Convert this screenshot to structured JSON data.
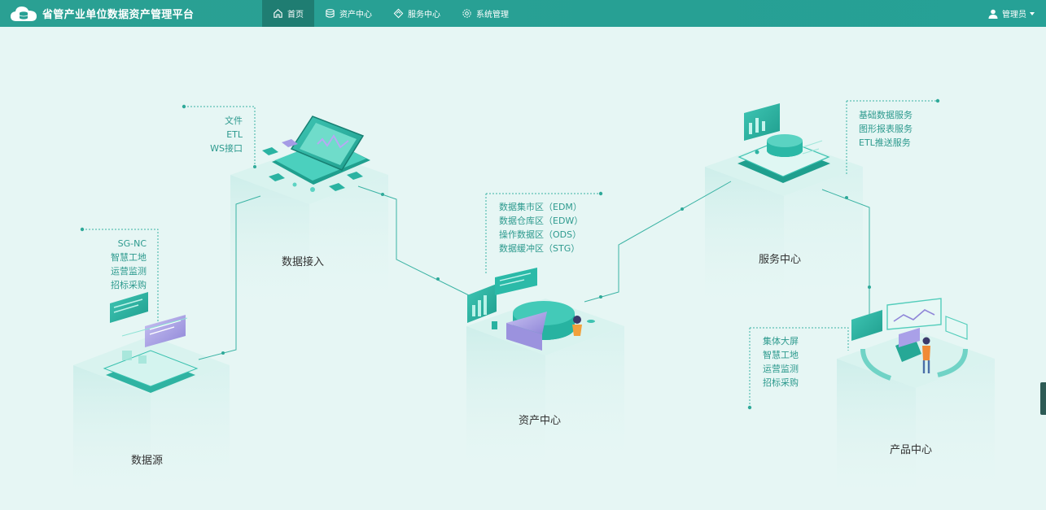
{
  "app": {
    "title": "省管产业单位数据资产管理平台",
    "logo_icon": "cloud-database-icon"
  },
  "nav": [
    {
      "label": "首页",
      "icon": "home-icon",
      "active": true
    },
    {
      "label": "资产中心",
      "icon": "database-icon",
      "active": false
    },
    {
      "label": "服务中心",
      "icon": "diamond-icon",
      "active": false
    },
    {
      "label": "系统管理",
      "icon": "gear-icon",
      "active": false
    }
  ],
  "user": {
    "label": "管理员",
    "icon": "user-icon"
  },
  "nodes": {
    "source": {
      "title": "数据源",
      "items": [
        "SG-NC",
        "智慧工地",
        "运营监测",
        "招标采购"
      ]
    },
    "ingest": {
      "title": "数据接入",
      "items": [
        "文件",
        "ETL",
        "WS接口"
      ]
    },
    "asset": {
      "title": "资产中心",
      "items": [
        "数据集市区（EDM）",
        "数据仓库区（EDW）",
        "操作数据区（ODS）",
        "数据缓冲区（STG）"
      ]
    },
    "service": {
      "title": "服务中心",
      "items": [
        "基础数据服务",
        "图形报表服务",
        "ETL推送服务"
      ]
    },
    "product": {
      "title": "产品中心",
      "items": [
        "集体大屏",
        "智慧工地",
        "运营监测",
        "招标采购"
      ]
    }
  },
  "colors": {
    "header": "#27a094",
    "nav_active": "#1f7d72",
    "accent": "#2d9a8e",
    "background": "#e6f6f4"
  }
}
